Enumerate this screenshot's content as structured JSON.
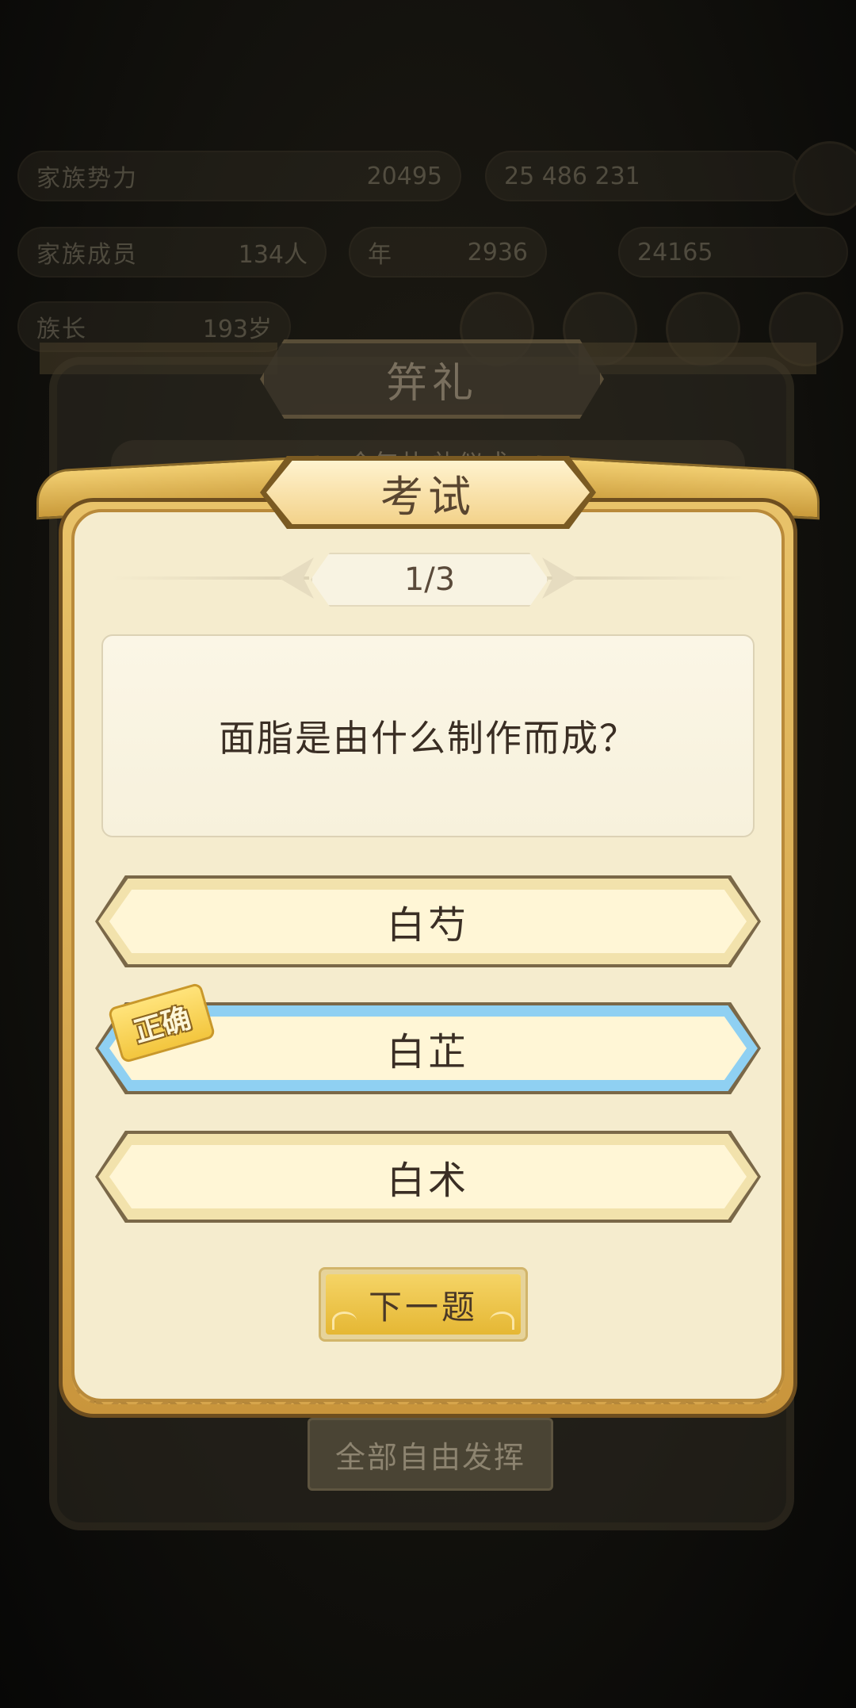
{
  "background": {
    "stats": [
      {
        "label": "家族势力",
        "value": "20495"
      },
      {
        "label": "",
        "value": "25 486 231"
      },
      {
        "label": "家族成员",
        "value": "134人"
      },
      {
        "label": "年",
        "value": "2936"
      },
      {
        "label": "",
        "value": "24165"
      },
      {
        "label": "族长",
        "value": "193岁"
      }
    ],
    "ceremony_title": "笄礼",
    "notice_text": "今年共 礼仪式",
    "bottom_button_label": "全部自由发挥"
  },
  "exam": {
    "title": "考试",
    "progress": "1/3",
    "question": "面脂是由什么制作而成？",
    "options": [
      {
        "label": "白芍",
        "state": "normal"
      },
      {
        "label": "白芷",
        "state": "correct"
      },
      {
        "label": "白术",
        "state": "normal"
      }
    ],
    "correct_tag": "正确",
    "next_button_label": "下一题"
  },
  "colors": {
    "modal_gold": "#e9c36a",
    "modal_inner": "#f5ecce",
    "correct_border": "#8fd0f2",
    "next_button": "#f5d466"
  }
}
